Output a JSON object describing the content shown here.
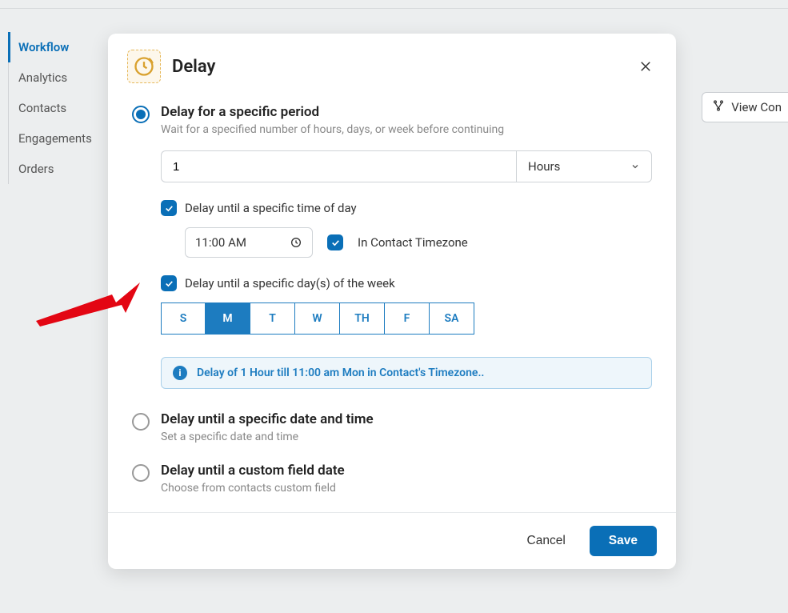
{
  "sidebar": {
    "items": [
      {
        "label": "Workflow",
        "active": true
      },
      {
        "label": "Analytics",
        "active": false
      },
      {
        "label": "Contacts",
        "active": false
      },
      {
        "label": "Engagements",
        "active": false
      },
      {
        "label": "Orders",
        "active": false
      }
    ]
  },
  "floating_button": {
    "label": "View Con"
  },
  "modal": {
    "title": "Delay",
    "close_label": "Close",
    "options": {
      "period": {
        "title": "Delay for a specific period",
        "subtitle": "Wait for a specified number of hours, days, or week before continuing",
        "number_value": "1",
        "units_value": "Hours",
        "time_of_day": {
          "enabled": true,
          "label": "Delay until a specific time of day",
          "time_value": "11:00 AM",
          "in_contact_tz_label": "In Contact Timezone",
          "in_contact_tz_enabled": true
        },
        "day_of_week": {
          "enabled": true,
          "label": "Delay until a specific day(s) of the week",
          "days": [
            {
              "abbr": "S",
              "selected": false
            },
            {
              "abbr": "M",
              "selected": true
            },
            {
              "abbr": "T",
              "selected": false
            },
            {
              "abbr": "W",
              "selected": false
            },
            {
              "abbr": "TH",
              "selected": false
            },
            {
              "abbr": "F",
              "selected": false
            },
            {
              "abbr": "SA",
              "selected": false
            }
          ]
        },
        "info_text": "Delay of 1 Hour till 11:00 am Mon in Contact's Timezone.."
      },
      "specific_date": {
        "title": "Delay until a specific date and time",
        "subtitle": "Set a specific date and time"
      },
      "custom_field": {
        "title": "Delay until a custom field date",
        "subtitle": "Choose from contacts custom field"
      }
    },
    "footer": {
      "cancel": "Cancel",
      "save": "Save"
    }
  }
}
